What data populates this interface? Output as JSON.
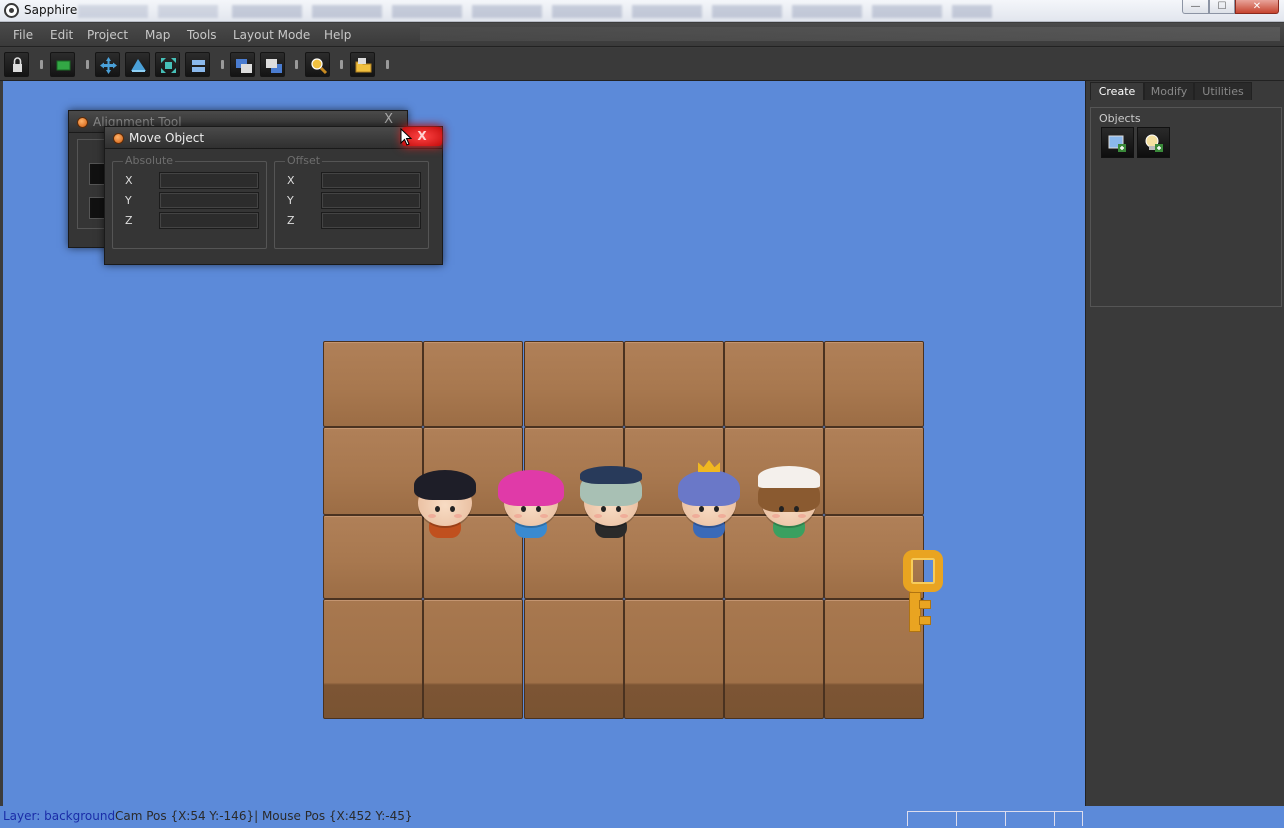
{
  "window": {
    "title": "Sapphire"
  },
  "menubar": {
    "items": [
      "File",
      "Edit",
      "Project",
      "Map",
      "Tools",
      "Layout Mode",
      "Help"
    ]
  },
  "toolbar": {
    "buttons": [
      "lock-icon",
      "layer-icon",
      "move-icon",
      "rotate-icon",
      "scale-icon",
      "align-icon",
      "bring-forward-icon",
      "send-backward-icon",
      "zoom-icon",
      "folder-icon"
    ]
  },
  "alignment_tool": {
    "title": "Alignment Tool",
    "close_label": "X"
  },
  "move_object": {
    "title": "Move Object",
    "close_label": "X",
    "absolute": {
      "legend": "Absolute",
      "x_label": "X",
      "y_label": "Y",
      "z_label": "Z",
      "x_value": "",
      "y_value": "",
      "z_value": ""
    },
    "offset": {
      "legend": "Offset",
      "x_label": "X",
      "y_label": "Y",
      "z_label": "Z",
      "x_value": "",
      "y_value": "",
      "z_value": ""
    }
  },
  "dock": {
    "tabs": [
      "Create",
      "Modify",
      "Utilities"
    ],
    "active_tab": "Create",
    "objects_legend": "Objects",
    "object_buttons": [
      "add-image-object-icon",
      "add-light-object-icon"
    ]
  },
  "scene": {
    "background": "#5c8ad9",
    "characters": [
      "dark-hair-boy",
      "pink-hair-girl",
      "silver-hair-pirate",
      "crowned-prince",
      "cat-hat-girl"
    ],
    "item": "golden-key"
  },
  "statusbar": {
    "layer": "Layer: background",
    "positions": "Cam Pos {X:54 Y:-146}| Mouse Pos {X:452 Y:-45}"
  }
}
